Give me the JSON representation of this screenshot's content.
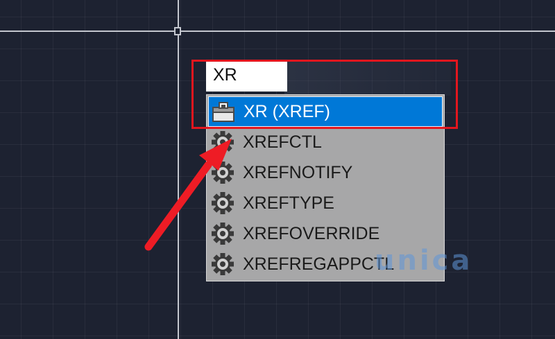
{
  "command_line": {
    "input_value": "XR"
  },
  "autocomplete": {
    "items": [
      {
        "label": "XR (XREF)",
        "icon": "xref-palette-icon",
        "selected": true
      },
      {
        "label": "XREFCTL",
        "icon": "gear-icon",
        "selected": false
      },
      {
        "label": "XREFNOTIFY",
        "icon": "gear-icon",
        "selected": false
      },
      {
        "label": "XREFTYPE",
        "icon": "gear-icon",
        "selected": false
      },
      {
        "label": "XREFOVERRIDE",
        "icon": "gear-icon",
        "selected": false
      },
      {
        "label": "XREFREGAPPCTL",
        "icon": "gear-icon",
        "selected": false
      }
    ]
  },
  "watermark": {
    "text": "unica"
  },
  "colors": {
    "canvas_background": "#1d2231",
    "selection": "#0078d7",
    "dropdown_background": "#a7a7a8",
    "annotation_red": "#e3161e"
  }
}
